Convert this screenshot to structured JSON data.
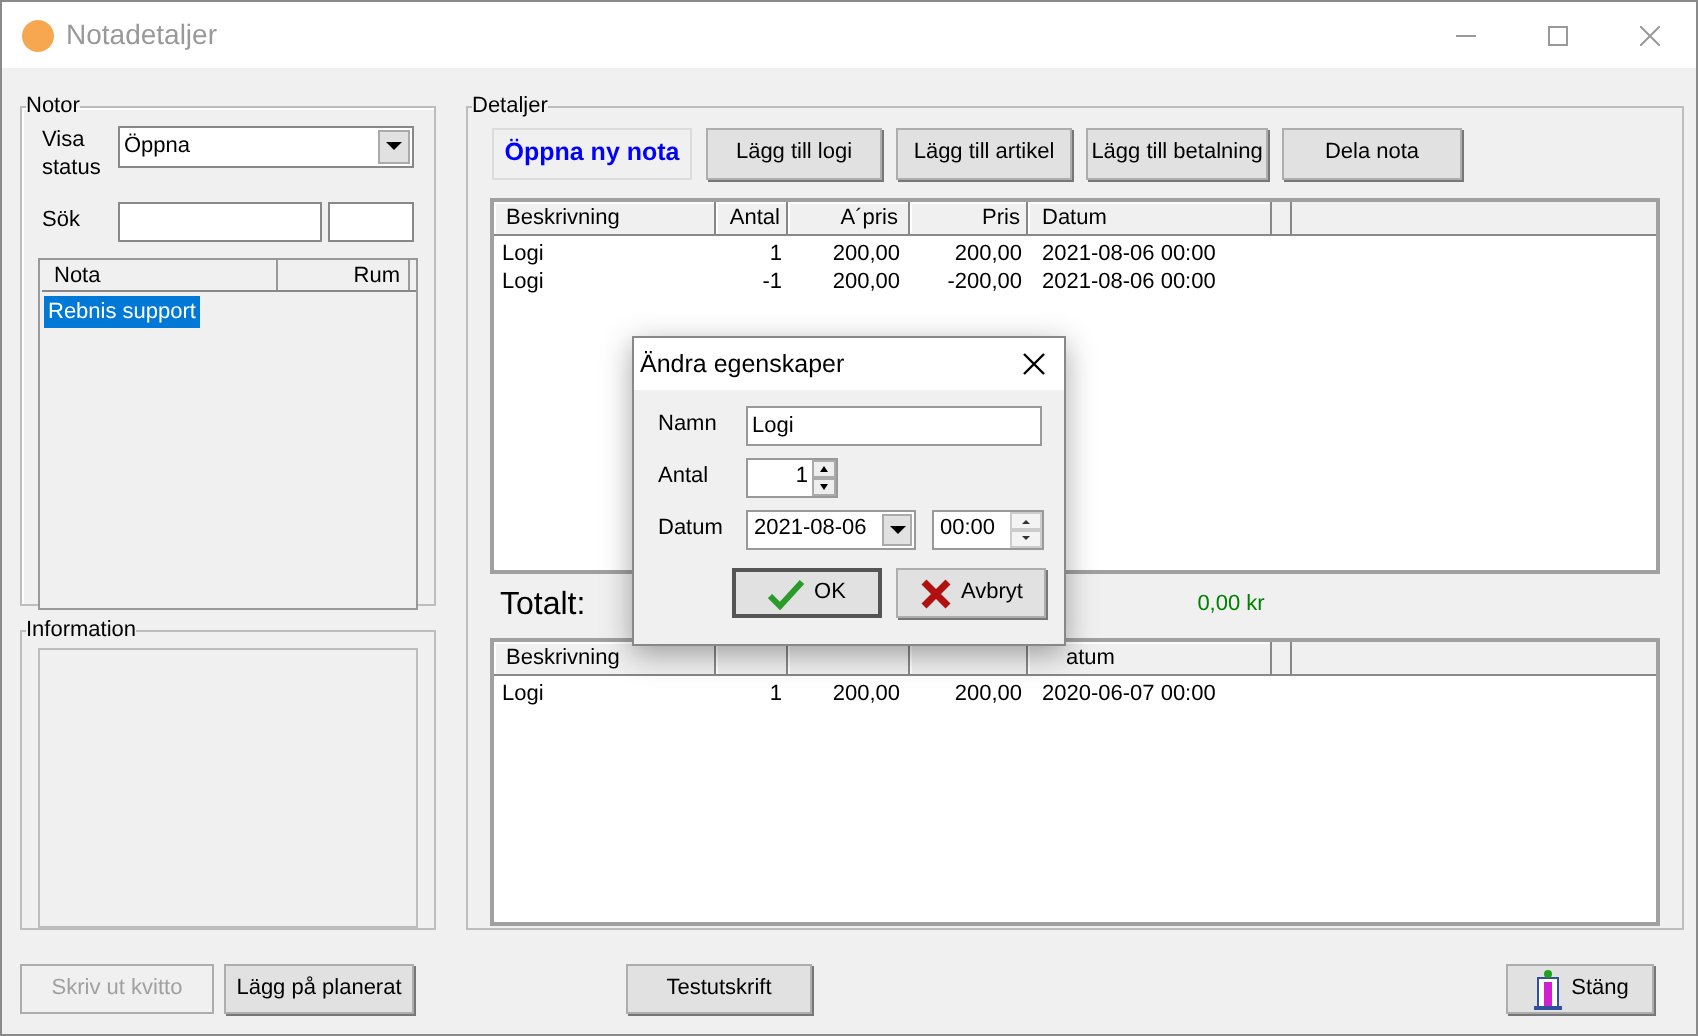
{
  "window": {
    "title": "Notadetaljer"
  },
  "notor": {
    "title": "Notor",
    "status_label": "Visa status",
    "status_value": "Öppna",
    "search_label": "Sök",
    "list": {
      "columns": [
        "Nota",
        "Rum"
      ],
      "rows": [
        {
          "nota": "Rebnis support",
          "selected": true
        }
      ]
    }
  },
  "information": {
    "title": "Information"
  },
  "detaljer": {
    "title": "Detaljer",
    "buttons": [
      {
        "label": "Öppna ny nota",
        "kind": "highlight"
      },
      {
        "label": "Lägg till logi",
        "kind": "normal"
      },
      {
        "label": "Lägg till artikel",
        "kind": "normal"
      },
      {
        "label": "Lägg till betalning",
        "kind": "normal"
      },
      {
        "label": "Dela nota",
        "kind": "normal"
      }
    ],
    "table": {
      "columns": [
        "Beskrivning",
        "Antal",
        "A´pris",
        "Pris",
        "Datum"
      ],
      "rows": [
        [
          "Logi",
          "1",
          "200,00",
          "200,00",
          "2021-08-06 00:00"
        ],
        [
          "Logi",
          "-1",
          "200,00",
          "-200,00",
          "2021-08-06 00:00"
        ]
      ]
    },
    "total_label": "Totalt:",
    "total_value": "0,00 kr",
    "lower_table": {
      "columns": [
        {
          "label": "Beskrivning"
        },
        {
          "covered": true
        },
        {
          "covered": true
        },
        {
          "covered": true
        },
        {
          "label": "atum"
        }
      ],
      "rows": [
        [
          "Logi",
          "1",
          "200,00",
          "200,00",
          "2020-06-07 00:00"
        ]
      ]
    }
  },
  "buttons": [
    {
      "label": "Skriv ut kvitto",
      "disabled": true
    },
    {
      "label": "Lägg på planerat",
      "disabled": false
    },
    {
      "label": "Testutskrift",
      "disabled": false
    },
    {
      "label": "Stäng",
      "disabled": false
    }
  ],
  "dialog": {
    "title": "Ändra egenskaper",
    "fields": [
      {
        "label": "Namn",
        "value": "Logi",
        "kind": "text"
      },
      {
        "label": "Antal",
        "value": "1",
        "kind": "spinner"
      },
      {
        "label": "Datum",
        "value": "2021-08-06",
        "time": "00:00",
        "kind": "datetime"
      }
    ],
    "buttons": [
      {
        "label": "OK",
        "kind": "ok",
        "focused": true
      },
      {
        "label": "Avbryt",
        "kind": "cancel",
        "focused": false
      }
    ]
  }
}
